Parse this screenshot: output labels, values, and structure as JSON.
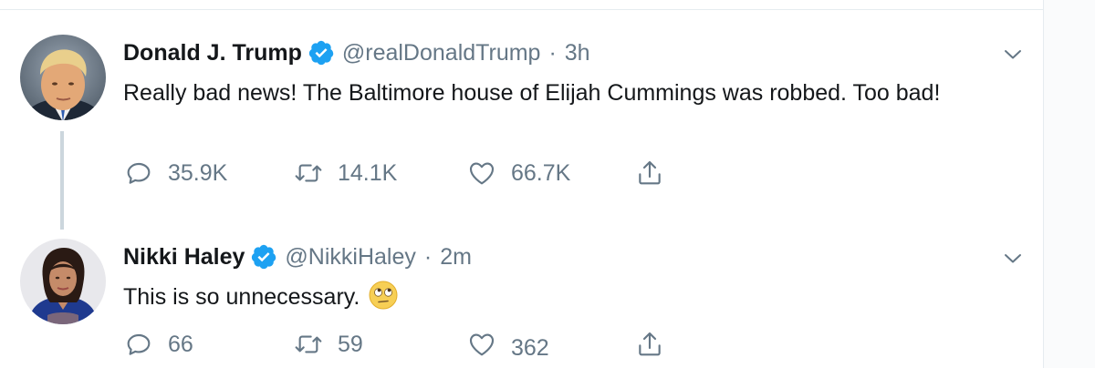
{
  "tweets": [
    {
      "display_name": "Donald J. Trump",
      "handle": "@realDonaldTrump",
      "separator": "·",
      "time": "3h",
      "text": "Really bad news! The Baltimore house of Elijah Cummings was robbed. Too bad!",
      "replies": "35.9K",
      "retweets": "14.1K",
      "likes": "66.7K",
      "avatar_icon": "avatar-photo",
      "verified_icon": "verified-badge-icon"
    },
    {
      "display_name": "Nikki Haley",
      "handle": "@NikkiHaley",
      "separator": "·",
      "time": "2m",
      "text": "This is so unnecessary.",
      "emoji": "face-with-rolling-eyes-emoji",
      "replies": "66",
      "retweets": "59",
      "likes": "362",
      "avatar_icon": "avatar-photo",
      "verified_icon": "verified-badge-icon"
    }
  ],
  "colors": {
    "text_primary": "#14171a",
    "text_secondary": "#657786",
    "verified_blue": "#1da1f2",
    "divider": "#e6ecf0",
    "thread_line": "#ccd6dd"
  }
}
